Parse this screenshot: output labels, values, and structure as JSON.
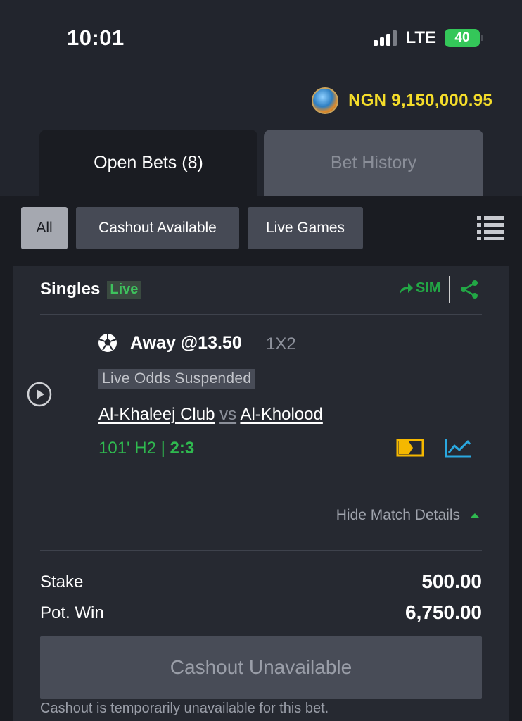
{
  "status_bar": {
    "time": "10:01",
    "network": "LTE",
    "battery": "40"
  },
  "account": {
    "balance": "NGN 9,150,000.95"
  },
  "tabs": [
    {
      "label": "Open Bets (8)",
      "active": true
    },
    {
      "label": "Bet History",
      "active": false
    }
  ],
  "filters": [
    {
      "label": "All",
      "selected": true
    },
    {
      "label": "Cashout Available",
      "selected": false
    },
    {
      "label": "Live Games",
      "selected": false
    }
  ],
  "bet": {
    "type": "Singles",
    "live_badge": "Live",
    "sim_label": "SIM",
    "selection": "Away @13.50",
    "market": "1X2",
    "odds_status": "Live Odds Suspended",
    "home_team": "Al-Khaleej Club",
    "vs": "vs",
    "away_team": "Al-Kholood",
    "match_time": "101' H2 |",
    "score": "2:3",
    "hide_details": "Hide Match Details",
    "stake_label": "Stake",
    "stake_value": "500.00",
    "pot_win_label": "Pot. Win",
    "pot_win_value": "6,750.00",
    "cashout_button": "Cashout Unavailable",
    "cashout_note": "Cashout is temporarily unavailable for this bet."
  },
  "colors": {
    "background": "#22252d",
    "card": "#262931",
    "accent_green": "#2fb94f",
    "balance_yellow": "#f5dd2a",
    "tv_icon_yellow": "#f5b800",
    "stats_icon_blue": "#2aa8e0"
  },
  "icons": [
    "signal-icon",
    "battery-icon",
    "coin-avatar-icon",
    "list-view-icon",
    "share-arrow-icon",
    "share-icon",
    "play-icon",
    "soccer-ball-icon",
    "live-tv-icon",
    "stats-chart-icon",
    "caret-up-icon"
  ]
}
